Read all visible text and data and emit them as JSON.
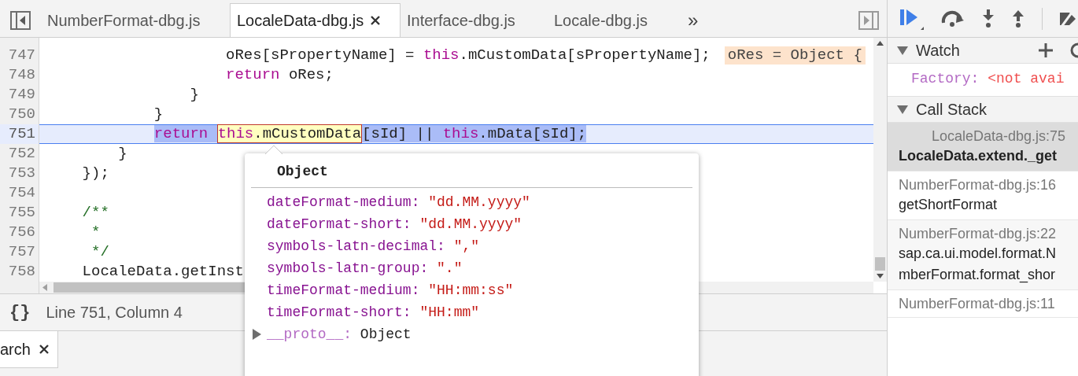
{
  "tabs": [
    {
      "label": "NumberFormat-dbg.js",
      "selected": false
    },
    {
      "label": "LocaleData-dbg.js",
      "selected": true
    },
    {
      "label": "Interface-dbg.js",
      "selected": false
    },
    {
      "label": "Locale-dbg.js",
      "selected": false
    }
  ],
  "tab_overflow": "»",
  "code_lines": [
    {
      "number": "747",
      "current": false,
      "segments": [
        {
          "text": "                    oRes[sPropertyName] = ",
          "kind": "plain"
        },
        {
          "text": "this",
          "kind": "keyword"
        },
        {
          "text": ".mCustomData[sPropertyName];",
          "kind": "plain"
        }
      ],
      "inline_value": "oRes = Object {"
    },
    {
      "number": "748",
      "current": false,
      "segments": [
        {
          "text": "                    return",
          "kind": "keyword"
        },
        {
          "text": " oRes;",
          "kind": "plain"
        }
      ]
    },
    {
      "number": "749",
      "current": false,
      "segments": [
        {
          "text": "                }",
          "kind": "plain"
        }
      ]
    },
    {
      "number": "750",
      "current": false,
      "segments": [
        {
          "text": "            }",
          "kind": "plain"
        }
      ]
    },
    {
      "number": "751",
      "current": true,
      "segments": [
        {
          "text": "            return ",
          "kind": "keyword",
          "selected": true,
          "hovered": false
        },
        {
          "text": "this",
          "kind": "keyword",
          "selected": false,
          "hovered": true
        },
        {
          "text": ".mCustomData",
          "kind": "plain",
          "selected": false,
          "hovered": true
        },
        {
          "text": "[sId] || ",
          "kind": "plain",
          "selected": true,
          "hovered": false
        },
        {
          "text": "this",
          "kind": "keyword",
          "selected": true,
          "hovered": false
        },
        {
          "text": ".mData[sId];",
          "kind": "plain",
          "selected": true,
          "hovered": false
        }
      ]
    },
    {
      "number": "752",
      "current": false,
      "segments": [
        {
          "text": "        }",
          "kind": "plain"
        }
      ]
    },
    {
      "number": "753",
      "current": false,
      "segments": [
        {
          "text": "    });",
          "kind": "plain"
        }
      ]
    },
    {
      "number": "754",
      "current": false
    },
    {
      "number": "755",
      "current": false,
      "segments": [
        {
          "text": "    /**",
          "kind": "comment"
        }
      ]
    },
    {
      "number": "756",
      "current": false,
      "segments": [
        {
          "text": "     *",
          "kind": "comment"
        }
      ]
    },
    {
      "number": "757",
      "current": false,
      "segments": [
        {
          "text": "     */",
          "kind": "comment"
        }
      ]
    },
    {
      "number": "758",
      "current": false,
      "segments": [
        {
          "text": "    LocaleData.getInst",
          "kind": "plain"
        }
      ]
    }
  ],
  "status_bar": {
    "pretty_print": "{}",
    "position": "Line 751, Column 4"
  },
  "drawer_tab": {
    "label": "arch",
    "selected": true
  },
  "popover": {
    "title": "Object",
    "properties": [
      {
        "name": "dateFormat-medium:",
        "value": "\"dd.MM.yyyy\"",
        "kind": "string",
        "expandable": false
      },
      {
        "name": "dateFormat-short:",
        "value": "\"dd.MM.yyyy\"",
        "kind": "string",
        "expandable": false
      },
      {
        "name": "symbols-latn-decimal:",
        "value": "\",\"",
        "kind": "string",
        "expandable": false
      },
      {
        "name": "symbols-latn-group:",
        "value": "\".\"",
        "kind": "string",
        "expandable": false
      },
      {
        "name": "timeFormat-medium:",
        "value": "\"HH:mm:ss\"",
        "kind": "string",
        "expandable": false
      },
      {
        "name": "timeFormat-short:",
        "value": "\"HH:mm\"",
        "kind": "string",
        "expandable": false
      },
      {
        "name": "__proto__:",
        "value": "Object",
        "kind": "object",
        "expandable": true
      }
    ]
  },
  "sidebar": {
    "watch": {
      "title": "Watch",
      "expanded": true,
      "items": [
        {
          "name": "Factory:",
          "value": "<not avai"
        }
      ]
    },
    "call_stack": {
      "title": "Call Stack",
      "expanded": true,
      "frames": [
        {
          "location": "LocaleData-dbg.js:75",
          "function_lines": [
            "LocaleData.extend._get"
          ],
          "selected": true
        },
        {
          "location": "NumberFormat-dbg.js:16",
          "function_lines": [
            "getShortFormat"
          ],
          "selected": false
        },
        {
          "location": "NumberFormat-dbg.js:22",
          "function_lines": [
            "sap.ca.ui.model.format.N",
            "mberFormat.format_shor"
          ],
          "selected": false
        },
        {
          "location": "NumberFormat-dbg.js:11",
          "selected": false
        }
      ]
    }
  }
}
